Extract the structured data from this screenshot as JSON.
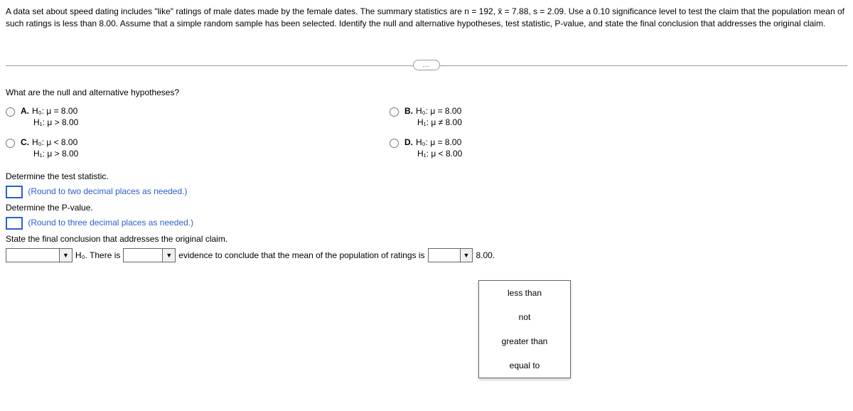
{
  "intro": "A data set about speed dating includes \"like\" ratings of male dates made by the female dates. The summary statistics are n = 192, x̄ = 7.88, s = 2.09. Use a 0.10 significance level to test the claim that the population mean of such ratings is less than 8.00. Assume that a simple random sample has been selected. Identify the null and alternative hypotheses, test statistic, P-value, and state the final conclusion that addresses the original claim.",
  "ellipsis": "…",
  "q1": "What are the null and alternative hypotheses?",
  "options": {
    "A": {
      "label": "A.",
      "h0": "H₀: μ = 8.00",
      "h1": "H₁: μ > 8.00"
    },
    "B": {
      "label": "B.",
      "h0": "H₀: μ = 8.00",
      "h1": "H₁: μ ≠ 8.00"
    },
    "C": {
      "label": "C.",
      "h0": "H₀: μ < 8.00",
      "h1": "H₁: μ > 8.00"
    },
    "D": {
      "label": "D.",
      "h0": "H₀: μ = 8.00",
      "h1": "H₁: μ < 8.00"
    }
  },
  "teststat": {
    "prompt": "Determine the test statistic.",
    "instruction": "(Round to two decimal places as needed.)"
  },
  "pvalue": {
    "prompt": "Determine the P-value.",
    "instruction": "(Round to three decimal places as needed.)"
  },
  "conclusion_prompt": "State the final conclusion that addresses the original claim.",
  "conclusion": {
    "h0_text": " H₀. There is ",
    "evidence_text": " evidence to conclude that the mean of the population of ratings is ",
    "end_text": " 8.00."
  },
  "dropdown_items": [
    "less than",
    "not",
    "greater than",
    "equal to"
  ]
}
